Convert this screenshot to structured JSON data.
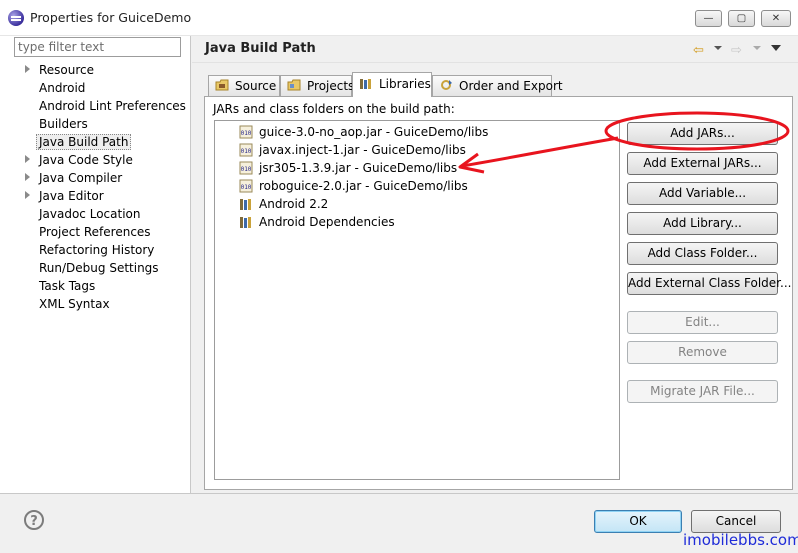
{
  "window": {
    "title": "Properties for GuiceDemo",
    "min_glyph": "—",
    "max_glyph": "▢",
    "close_glyph": "✕"
  },
  "filter": {
    "placeholder": "type filter text"
  },
  "nav": {
    "items": [
      {
        "label": "Resource",
        "expandable": true
      },
      {
        "label": "Android",
        "expandable": false
      },
      {
        "label": "Android Lint Preferences",
        "expandable": false
      },
      {
        "label": "Builders",
        "expandable": false
      },
      {
        "label": "Java Build Path",
        "expandable": false,
        "selected": true
      },
      {
        "label": "Java Code Style",
        "expandable": true
      },
      {
        "label": "Java Compiler",
        "expandable": true
      },
      {
        "label": "Java Editor",
        "expandable": true
      },
      {
        "label": "Javadoc Location",
        "expandable": false
      },
      {
        "label": "Project References",
        "expandable": false
      },
      {
        "label": "Refactoring History",
        "expandable": false
      },
      {
        "label": "Run/Debug Settings",
        "expandable": false
      },
      {
        "label": "Task Tags",
        "expandable": false
      },
      {
        "label": "XML Syntax",
        "expandable": false
      }
    ]
  },
  "page": {
    "title": "Java Build Path",
    "back_glyph": "⇦",
    "forward_glyph": "⇨"
  },
  "tabs": [
    {
      "label": "Source",
      "icon": "source-folder-icon"
    },
    {
      "label": "Projects",
      "icon": "projects-icon"
    },
    {
      "label": "Libraries",
      "icon": "libraries-icon",
      "active": true
    },
    {
      "label": "Order and Export",
      "icon": "order-export-icon"
    }
  ],
  "libraries": {
    "caption": "JARs and class folders on the build path:",
    "items": [
      {
        "label": "guice-3.0-no_aop.jar - GuiceDemo/libs",
        "icon": "jar-icon"
      },
      {
        "label": "javax.inject-1.jar - GuiceDemo/libs",
        "icon": "jar-icon"
      },
      {
        "label": "jsr305-1.3.9.jar - GuiceDemo/libs",
        "icon": "jar-icon"
      },
      {
        "label": "roboguice-2.0.jar - GuiceDemo/libs",
        "icon": "jar-icon"
      },
      {
        "label": "Android 2.2",
        "icon": "library-container-icon"
      },
      {
        "label": "Android Dependencies",
        "icon": "library-container-icon"
      }
    ]
  },
  "buttons": {
    "add_jars": "Add JARs...",
    "add_external_jars": "Add External JARs...",
    "add_variable": "Add Variable...",
    "add_library": "Add Library...",
    "add_class_folder": "Add Class Folder...",
    "add_external_class_folder": "Add External Class Folder...",
    "edit": "Edit...",
    "remove": "Remove",
    "migrate_jar": "Migrate JAR File..."
  },
  "footer": {
    "help_glyph": "?",
    "ok": "OK",
    "cancel": "Cancel"
  },
  "watermark": "imobilebbs.com",
  "colors": {
    "annotation_red": "#e8141e",
    "watermark_blue": "#1e2bd8",
    "ok_border": "#3c7fb1"
  }
}
